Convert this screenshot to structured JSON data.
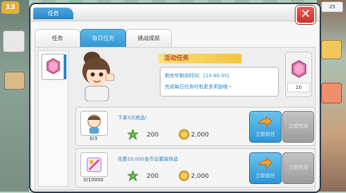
{
  "hud": {
    "level": "13",
    "top_right_counter": "25"
  },
  "dialog": {
    "title": "任务",
    "close_symbol": "✕",
    "tabs": [
      {
        "label": "任务",
        "active": false
      },
      {
        "label": "每日任务",
        "active": true
      },
      {
        "label": "挑战成就",
        "active": false
      }
    ]
  },
  "daily": {
    "banner": "活动任务",
    "timer_line": "剩完毕剩余时间：[13:40:35]",
    "hint_line": "完成每日任务时有更多奖励哦~",
    "reward_icon": "pink-gem-icon",
    "reward_value": "10"
  },
  "tasks": [
    {
      "description": "下单3次商品!",
      "progress": "0/3",
      "reward_star": "200",
      "reward_coin": "2,000",
      "go_label": "立即前往",
      "done_label": "立即完成"
    },
    {
      "description": "花费10,000金币设置装饰品",
      "progress": "0/10000",
      "reward_star": "200",
      "reward_coin": "2,000",
      "go_label": "立即前往",
      "done_label": "立即完成"
    }
  ],
  "colors": {
    "accent_blue": "#2f95d3",
    "close_red": "#d9403a",
    "text_blue": "#2b86c4",
    "gem_pink": "#e06fa6"
  }
}
